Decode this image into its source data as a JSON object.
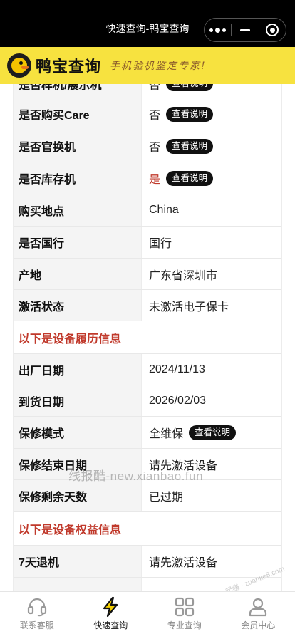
{
  "header": {
    "title": "快速查询-鸭宝查询"
  },
  "brand": {
    "name": "鸭宝查询",
    "slogan": "手机验机鉴定专家!"
  },
  "rows_top": [
    {
      "label": "是否样机/展示机",
      "value": "否",
      "value_color": "normal",
      "pill": "查看说明"
    },
    {
      "label": "是否购买Care",
      "value": "否",
      "value_color": "normal",
      "pill": "查看说明"
    },
    {
      "label": "是否官换机",
      "value": "否",
      "value_color": "normal",
      "pill": "查看说明"
    },
    {
      "label": "是否库存机",
      "value": "是",
      "value_color": "red",
      "pill": "查看说明"
    },
    {
      "label": "购买地点",
      "value": "China"
    },
    {
      "label": "是否国行",
      "value": "国行"
    },
    {
      "label": "产地",
      "value": "广东省深圳市"
    },
    {
      "label": "激活状态",
      "value": "未激活电子保卡"
    }
  ],
  "section_history": "以下是设备履历信息",
  "rows_history": [
    {
      "label": "出厂日期",
      "value": "2024/11/13"
    },
    {
      "label": "到货日期",
      "value": "2026/02/03"
    },
    {
      "label": "保修模式",
      "value": "全维保",
      "pill": "查看说明"
    },
    {
      "label": "保修结束日期",
      "value": "请先激活设备"
    },
    {
      "label": "保修剩余天数",
      "value": "已过期",
      "value_color": "red"
    }
  ],
  "section_rights": "以下是设备权益信息",
  "rows_rights": [
    {
      "label": "7天退机",
      "value": "请先激活设备"
    }
  ],
  "watermark": "线报酷-new.xianbao.fun",
  "corner_stamp": "赚客吧, 有奖一起赚 · zuanke8.com",
  "tabbar": [
    {
      "label": "联系客服",
      "icon": "headset-icon",
      "active": false
    },
    {
      "label": "快速查询",
      "icon": "lightning-icon",
      "active": true
    },
    {
      "label": "专业查询",
      "icon": "grid-icon",
      "active": false
    },
    {
      "label": "会员中心",
      "icon": "user-icon",
      "active": false
    }
  ],
  "colors": {
    "header_bg": "#000000",
    "brand_bg": "#f7e23f",
    "accent_red": "#c0392b",
    "pill_bg": "#111111"
  }
}
